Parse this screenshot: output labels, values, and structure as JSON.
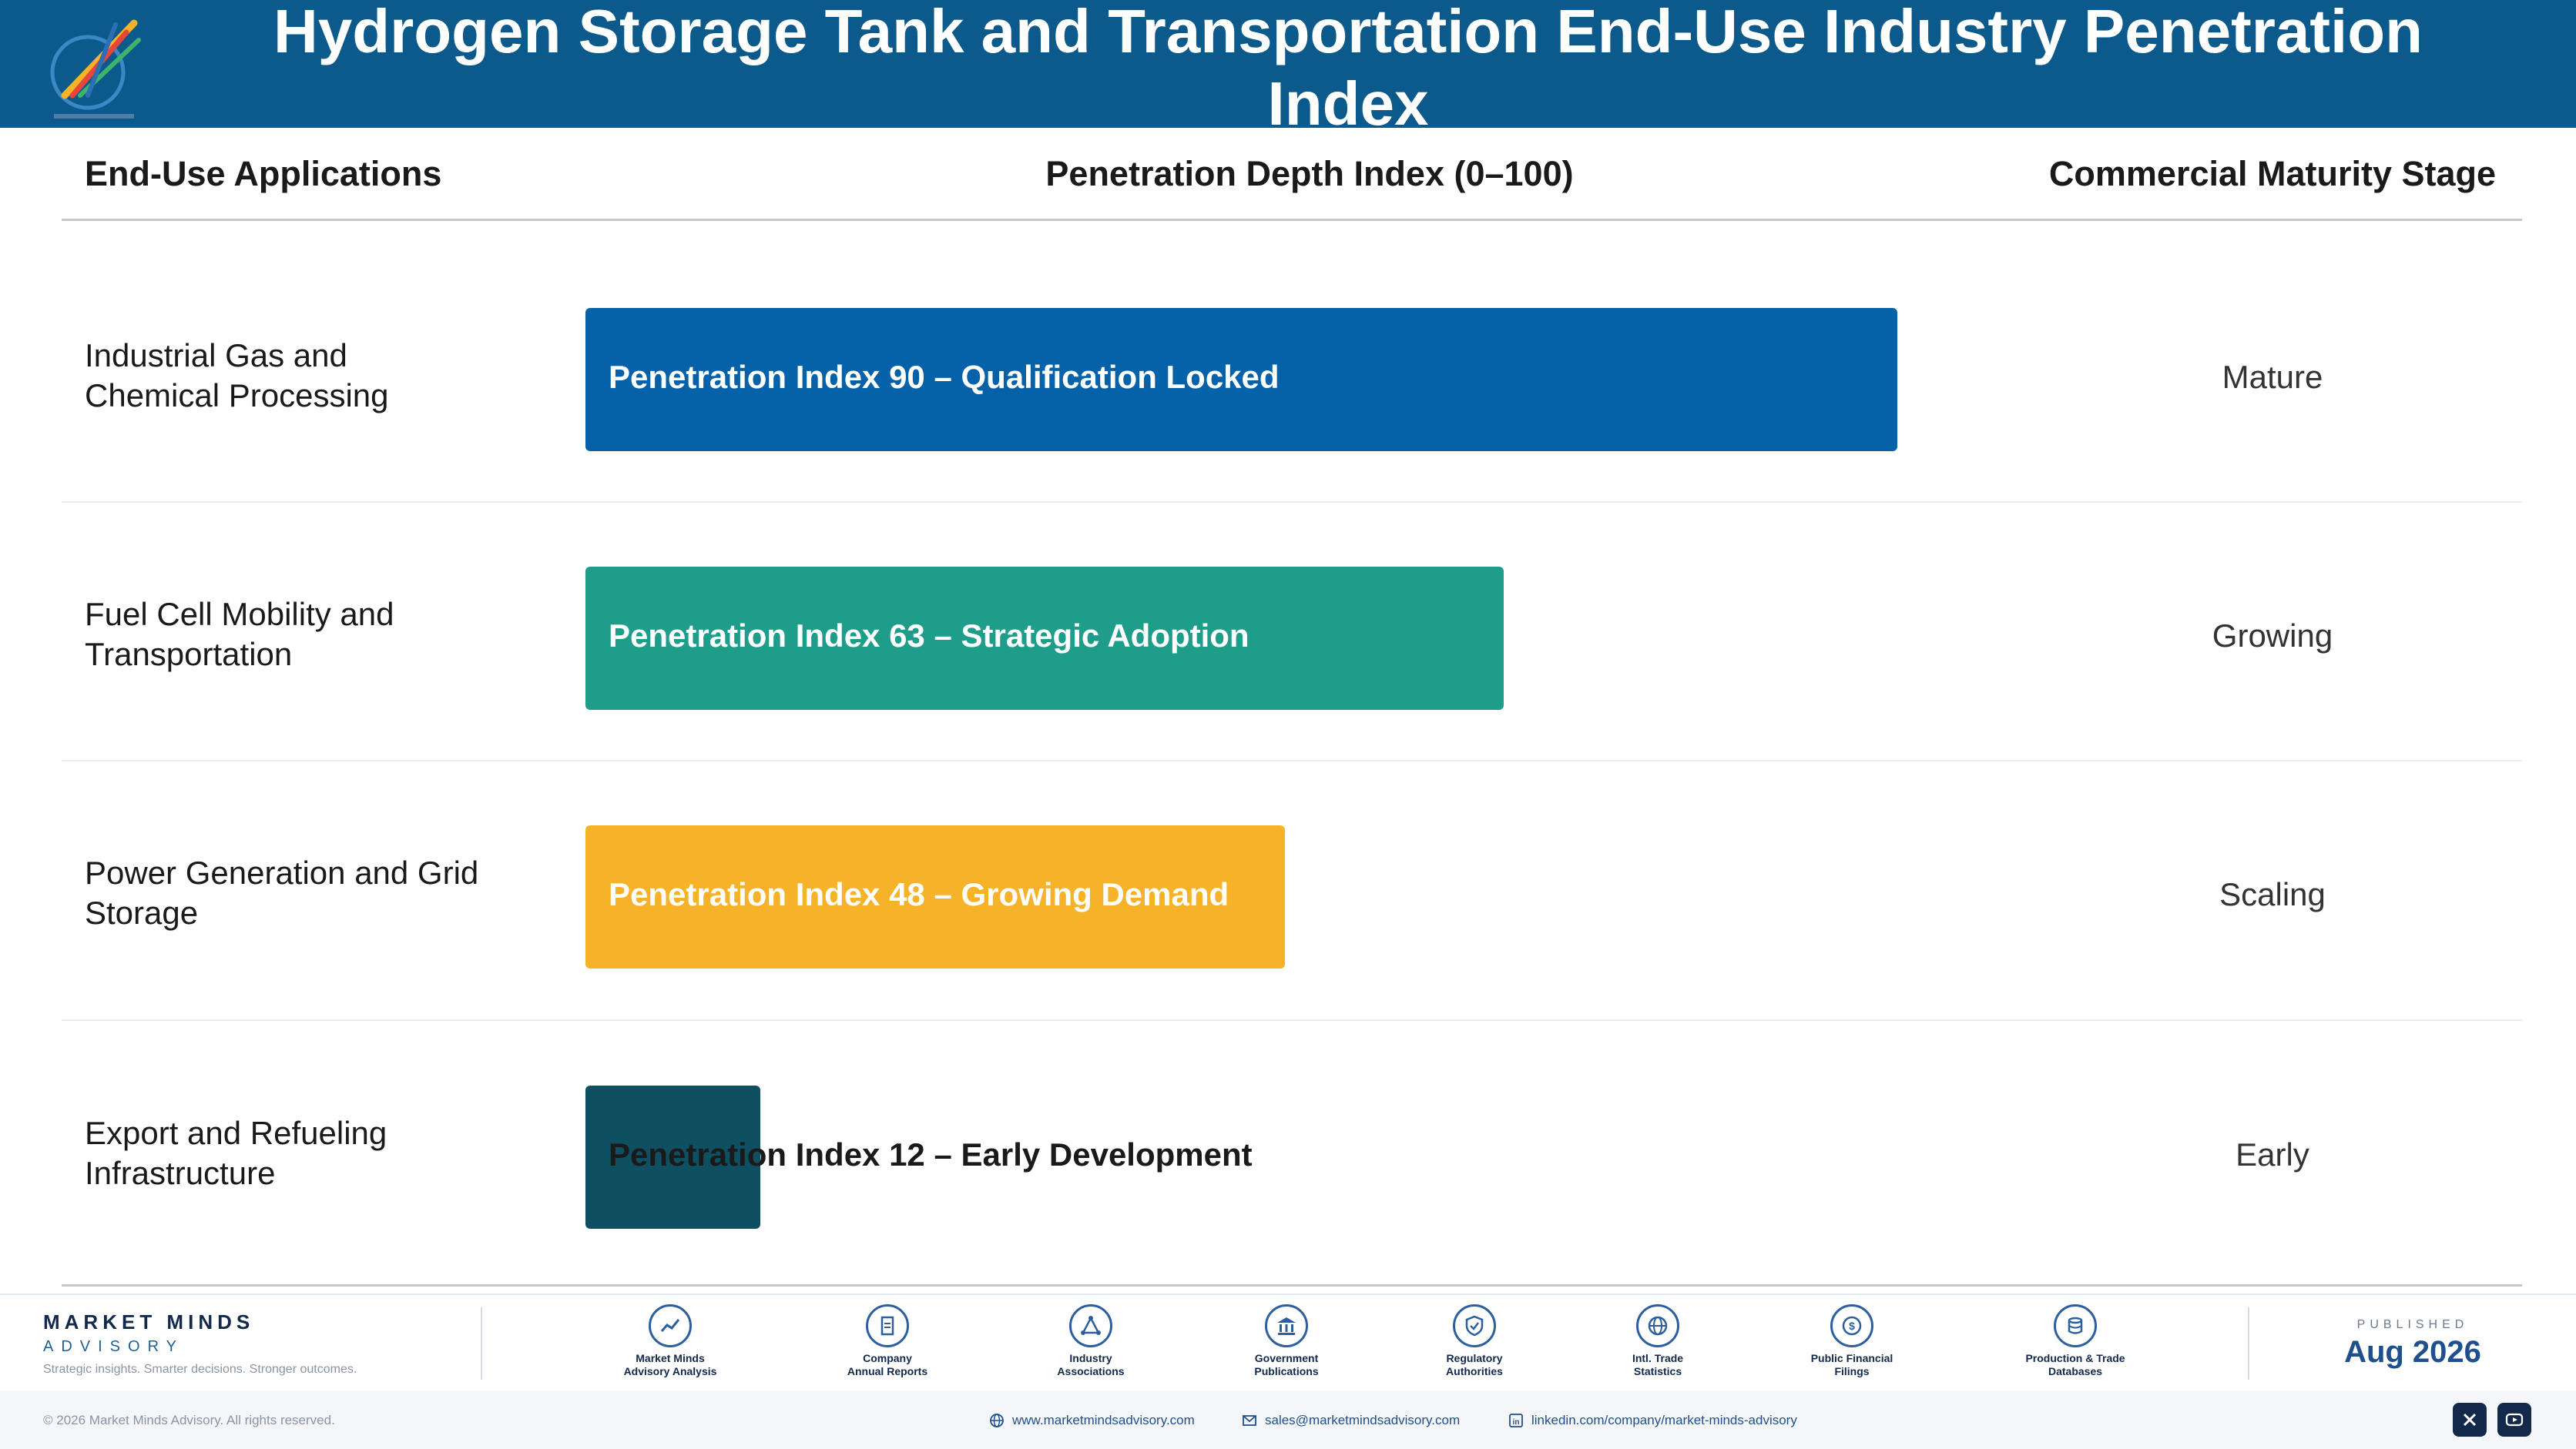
{
  "header": {
    "title_line1": "Hydrogen Storage Tank and Transportation End-Use Industry Penetration",
    "title_line2": "Index",
    "logo_icon": "market-minds-logo"
  },
  "columns": {
    "application": "End-Use Applications",
    "index": "Penetration Depth Index (0–100)",
    "stage": "Commercial Maturity Stage"
  },
  "chart_data": {
    "type": "bar",
    "orientation": "horizontal",
    "categories": [
      "Industrial Gas and Chemical Processing",
      "Fuel Cell Mobility and Transportation",
      "Power Generation and Grid Storage",
      "Export and Refueling Infrastructure"
    ],
    "values": [
      90,
      63,
      48,
      12
    ],
    "xlim": [
      0,
      100
    ],
    "bar_labels": [
      "Penetration Index 90 – Qualification Locked",
      "Penetration Index 63 – Strategic Adoption",
      "Penetration Index 48 – Growing Demand",
      "Penetration Index 12 – Early Development"
    ],
    "stages": [
      "Mature",
      "Growing",
      "Scaling",
      "Early"
    ],
    "colors": [
      "#0562a9",
      "#1e9e8a",
      "#f6b229",
      "#0f4f62"
    ]
  },
  "rows_text": [
    {
      "line1": "Industrial Gas and",
      "line2": "Chemical Processing"
    },
    {
      "line1": "Fuel Cell Mobility and",
      "line2": "Transportation"
    },
    {
      "line1": "Power Generation and Grid",
      "line2": "Storage"
    },
    {
      "line1": "Export and Refueling",
      "line2": "Infrastructure"
    }
  ],
  "footer": {
    "brand_name": "MARKET MINDS",
    "brand_sub": "ADVISORY",
    "brand_tagline": "Strategic insights. Smarter decisions. Stronger outcomes.",
    "sources": [
      {
        "icon": "line-chart-icon",
        "line1": "Market Minds",
        "line2": "Advisory Analysis"
      },
      {
        "icon": "document-icon",
        "line1": "Company",
        "line2": "Annual Reports"
      },
      {
        "icon": "network-icon",
        "line1": "Industry",
        "line2": "Associations"
      },
      {
        "icon": "government-building-icon",
        "line1": "Government",
        "line2": "Publications"
      },
      {
        "icon": "shield-check-icon",
        "line1": "Regulatory",
        "line2": "Authorities"
      },
      {
        "icon": "globe-icon",
        "line1": "Intl. Trade",
        "line2": "Statistics"
      },
      {
        "icon": "coin-icon",
        "line1": "Public Financial",
        "line2": "Filings"
      },
      {
        "icon": "database-icon",
        "line1": "Production & Trade",
        "line2": "Databases"
      }
    ],
    "published_label": "PUBLISHED",
    "published_date": "Aug 2026",
    "copyright": "© 2026 Market Minds Advisory. All rights reserved.",
    "website": "www.marketmindsadvisory.com",
    "email": "sales@marketmindsadvisory.com",
    "linkedin": "linkedin.com/company/market-minds-advisory",
    "social": [
      "x-icon",
      "youtube-icon"
    ]
  }
}
